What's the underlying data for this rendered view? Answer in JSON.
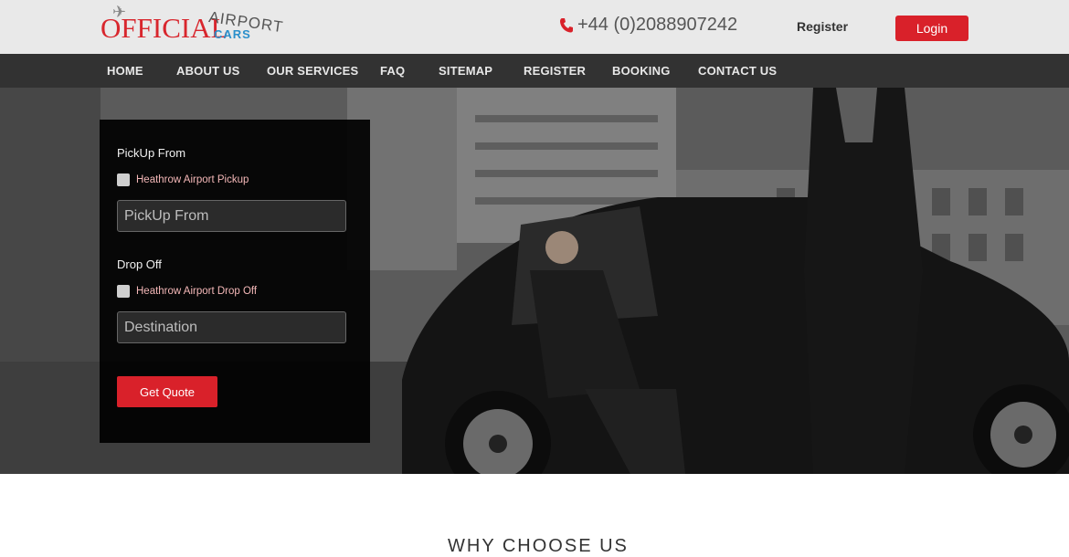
{
  "header": {
    "logo": {
      "word1": "OFFICIAL",
      "word2": "AIRPORT",
      "word3": "CARS"
    },
    "phone": "+44 (0)2088907242",
    "register_label": "Register",
    "login_label": "Login"
  },
  "nav": {
    "items": [
      "HOME",
      "ABOUT US",
      "OUR SERVICES",
      "FAQ",
      "SITEMAP",
      "REGISTER",
      "BOOKING",
      "CONTACT US"
    ]
  },
  "booking": {
    "pickup_label": "PickUp From",
    "pickup_checkbox": "Heathrow Airport Pickup",
    "pickup_placeholder": "PickUp From",
    "dropoff_label": "Drop Off",
    "dropoff_checkbox": "Heathrow Airport Drop Off",
    "dropoff_placeholder": "Destination",
    "quote_button": "Get Quote"
  },
  "section": {
    "why_title": "WHY CHOOSE US"
  },
  "colors": {
    "accent": "#d9212a",
    "nav_bg": "#323232",
    "header_bg": "#e9e9e9"
  },
  "icons": {
    "phone": "phone-icon"
  }
}
